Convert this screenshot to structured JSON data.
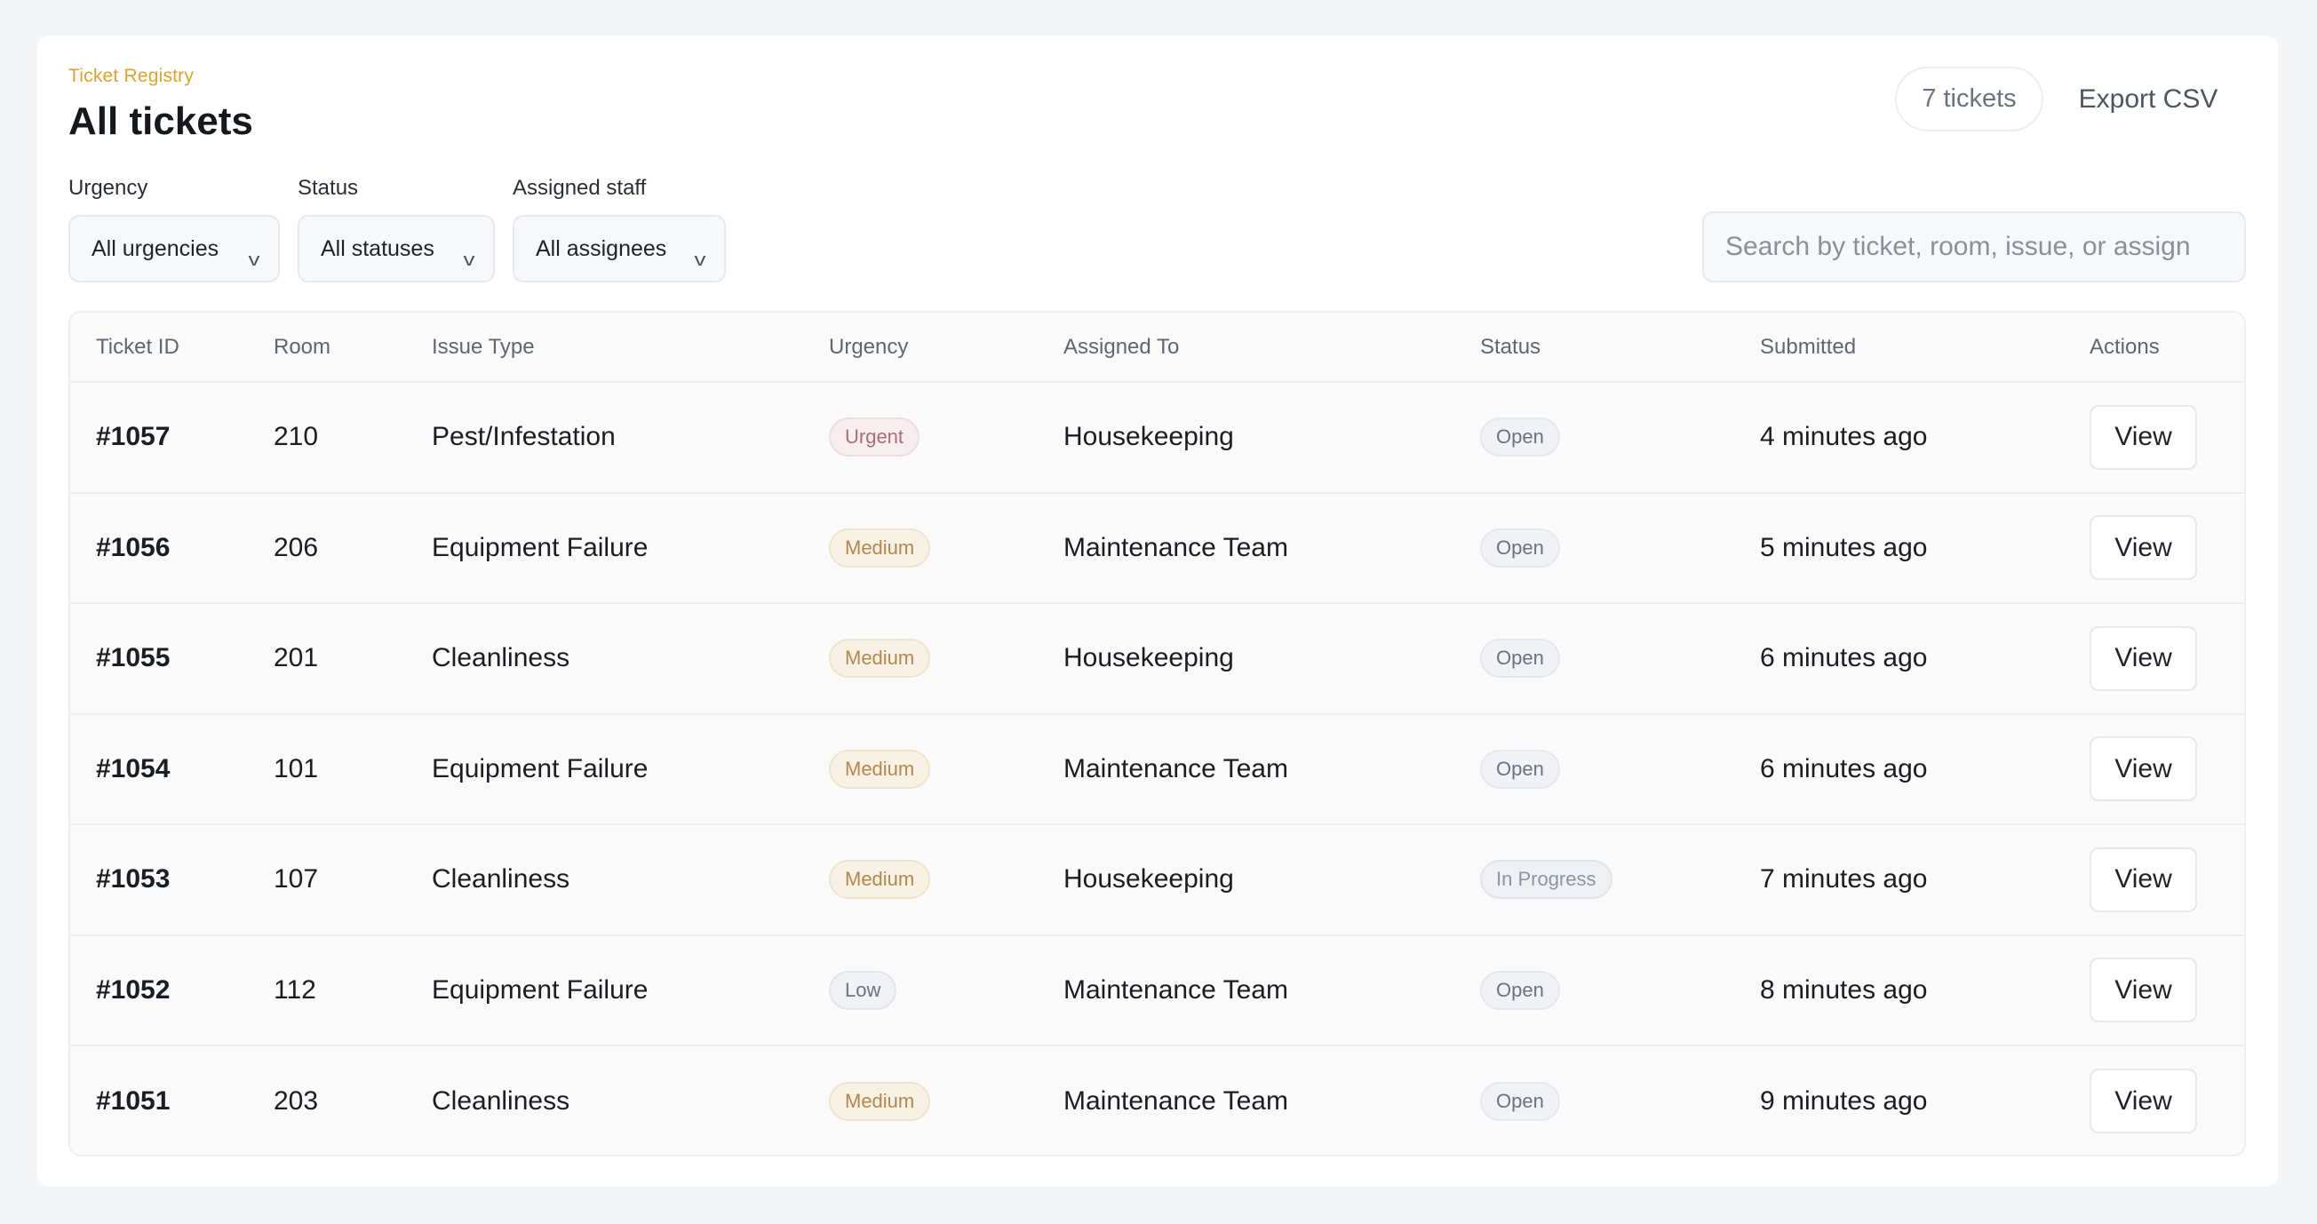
{
  "header": {
    "eyebrow": "Ticket Registry",
    "title": "All tickets",
    "ticket_count": "7 tickets",
    "export_label": "Export CSV"
  },
  "filters": {
    "urgency": {
      "label": "Urgency",
      "value": "All urgencies"
    },
    "status": {
      "label": "Status",
      "value": "All statuses"
    },
    "assignee": {
      "label": "Assigned staff",
      "value": "All assignees"
    }
  },
  "search": {
    "placeholder": "Search by ticket, room, issue, or assign"
  },
  "table": {
    "columns": [
      "Ticket ID",
      "Room",
      "Issue Type",
      "Urgency",
      "Assigned To",
      "Status",
      "Submitted",
      "Actions"
    ],
    "view_label": "View",
    "rows": [
      {
        "id": "#1057",
        "room": "210",
        "issue": "Pest/Infestation",
        "urgency": "Urgent",
        "assigned": "Housekeeping",
        "status": "Open",
        "submitted": "4 minutes ago"
      },
      {
        "id": "#1056",
        "room": "206",
        "issue": "Equipment Failure",
        "urgency": "Medium",
        "assigned": "Maintenance Team",
        "status": "Open",
        "submitted": "5 minutes ago"
      },
      {
        "id": "#1055",
        "room": "201",
        "issue": "Cleanliness",
        "urgency": "Medium",
        "assigned": "Housekeeping",
        "status": "Open",
        "submitted": "6 minutes ago"
      },
      {
        "id": "#1054",
        "room": "101",
        "issue": "Equipment Failure",
        "urgency": "Medium",
        "assigned": "Maintenance Team",
        "status": "Open",
        "submitted": "6 minutes ago"
      },
      {
        "id": "#1053",
        "room": "107",
        "issue": "Cleanliness",
        "urgency": "Medium",
        "assigned": "Housekeeping",
        "status": "In Progress",
        "submitted": "7 minutes ago"
      },
      {
        "id": "#1052",
        "room": "112",
        "issue": "Equipment Failure",
        "urgency": "Low",
        "assigned": "Maintenance Team",
        "status": "Open",
        "submitted": "8 minutes ago"
      },
      {
        "id": "#1051",
        "room": "203",
        "issue": "Cleanliness",
        "urgency": "Medium",
        "assigned": "Maintenance Team",
        "status": "Open",
        "submitted": "9 minutes ago"
      }
    ]
  },
  "colors": {
    "accent": "#e0a22a",
    "urgent": "#b06a7a",
    "medium": "#b4884a",
    "neutral": "#6b7280"
  }
}
